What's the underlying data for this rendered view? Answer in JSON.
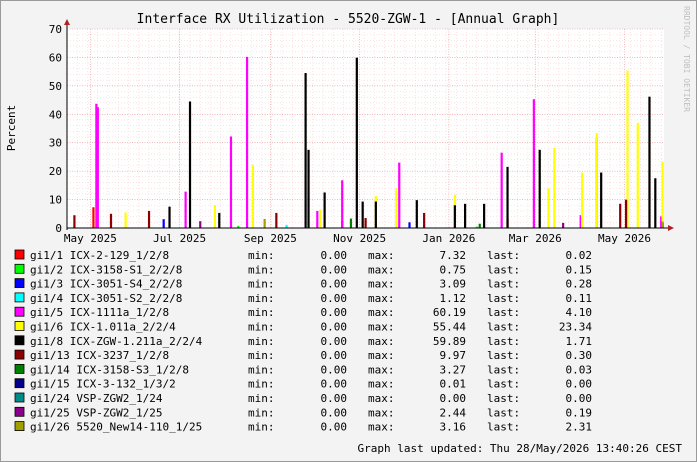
{
  "chart_data": {
    "type": "bar",
    "title": "Interface RX Utilization - 5520-ZGW-1 - [Annual Graph]",
    "ylabel": "Percent",
    "watermark": "RRDTOOL / TOBI OETIKER",
    "ylim": [
      0,
      70
    ],
    "y_ticks": [
      0,
      10,
      20,
      30,
      40,
      50,
      60,
      70
    ],
    "x_range": [
      "2025-04-15",
      "2026-05-28"
    ],
    "x_ticks": [
      {
        "label": "May 2025",
        "date": "2025-05-01"
      },
      {
        "label": "Jul 2025",
        "date": "2025-07-01"
      },
      {
        "label": "Sep 2025",
        "date": "2025-09-01"
      },
      {
        "label": "Nov 2025",
        "date": "2025-11-01"
      },
      {
        "label": "Jan 2026",
        "date": "2026-01-01"
      },
      {
        "label": "Mar 2026",
        "date": "2026-03-01"
      },
      {
        "label": "May 2026",
        "date": "2026-05-01"
      }
    ],
    "grid": true,
    "legend_columns": {
      "min": "min:",
      "max": "max:",
      "last": "last:"
    },
    "series": [
      {
        "name": "gi1/1 ICX-2-129_1/2/8",
        "color": "#ff0000",
        "min": "0.00",
        "max": "7.32",
        "last": "0.02",
        "peaks": [
          [
            "2025-05-03",
            7.3
          ],
          [
            "2026-02-10",
            3.2
          ],
          [
            "2025-10-20",
            2.5
          ]
        ]
      },
      {
        "name": "gi1/2 ICX-3158-S1_2/2/8",
        "color": "#00ff00",
        "min": "0.00",
        "max": "0.75",
        "last": "0.15",
        "peaks": [
          [
            "2025-08-10",
            0.75
          ],
          [
            "2026-01-20",
            0.5
          ]
        ]
      },
      {
        "name": "gi1/3 ICX-3051-S4_2/2/8",
        "color": "#0000ff",
        "min": "0.00",
        "max": "3.09",
        "last": "0.28",
        "peaks": [
          [
            "2025-06-20",
            3.1
          ],
          [
            "2025-12-05",
            2.0
          ]
        ]
      },
      {
        "name": "gi1/4 ICX-3051-S2_2/2/8",
        "color": "#00ffff",
        "min": "0.00",
        "max": "1.12",
        "last": "0.11",
        "peaks": [
          [
            "2025-09-12",
            1.1
          ]
        ]
      },
      {
        "name": "gi1/5 ICX-1111a_1/2/8",
        "color": "#ff00ff",
        "min": "0.00",
        "max": "60.19",
        "last": "4.10",
        "peaks": [
          [
            "2025-05-05",
            43.7
          ],
          [
            "2025-05-06",
            42.5
          ],
          [
            "2025-07-05",
            12.8
          ],
          [
            "2025-08-05",
            32.2
          ],
          [
            "2025-08-16",
            60.2
          ],
          [
            "2025-10-03",
            6.0
          ],
          [
            "2025-10-20",
            16.8
          ],
          [
            "2025-11-28",
            23.0
          ],
          [
            "2026-02-06",
            26.5
          ],
          [
            "2026-02-28",
            45.3
          ],
          [
            "2026-04-01",
            4.5
          ],
          [
            "2026-04-12",
            31.7
          ],
          [
            "2026-05-26",
            4.1
          ]
        ]
      },
      {
        "name": "gi1/6 ICX-1.011a_2/2/4",
        "color": "#ffff00",
        "min": "0.00",
        "max": "55.44",
        "last": "23.34",
        "peaks": [
          [
            "2025-05-25",
            5.5
          ],
          [
            "2025-07-25",
            8.0
          ],
          [
            "2025-08-20",
            22.2
          ],
          [
            "2025-10-05",
            6.5
          ],
          [
            "2025-11-12",
            11.2
          ],
          [
            "2025-11-26",
            14.0
          ],
          [
            "2026-01-05",
            11.7
          ],
          [
            "2026-03-10",
            14.0
          ],
          [
            "2026-03-14",
            28.2
          ],
          [
            "2026-04-02",
            19.5
          ],
          [
            "2026-04-12",
            33.4
          ],
          [
            "2026-05-03",
            55.4
          ],
          [
            "2026-05-10",
            37.0
          ],
          [
            "2026-05-27",
            23.3
          ]
        ]
      },
      {
        "name": "gi1/8 ICX-ZGW-1.211a_2/2/4",
        "color": "#000000",
        "min": "0.00",
        "max": "59.89",
        "last": "1.71",
        "peaks": [
          [
            "2025-06-24",
            7.5
          ],
          [
            "2025-07-08",
            44.5
          ],
          [
            "2025-07-28",
            5.3
          ],
          [
            "2025-09-25",
            54.5
          ],
          [
            "2025-09-27",
            27.5
          ],
          [
            "2025-10-08",
            12.5
          ],
          [
            "2025-10-30",
            59.9
          ],
          [
            "2025-11-03",
            9.3
          ],
          [
            "2025-11-12",
            9.3
          ],
          [
            "2025-12-10",
            9.8
          ],
          [
            "2026-01-05",
            8.0
          ],
          [
            "2026-01-12",
            8.5
          ],
          [
            "2026-01-25",
            8.5
          ],
          [
            "2026-02-10",
            21.5
          ],
          [
            "2026-03-04",
            27.5
          ],
          [
            "2026-04-15",
            19.5
          ],
          [
            "2026-05-18",
            46.2
          ],
          [
            "2026-05-22",
            17.5
          ],
          [
            "2026-05-27",
            1.7
          ]
        ]
      },
      {
        "name": "gi1/13 ICX-3237_1/2/8",
        "color": "#8b0000",
        "min": "0.00",
        "max": "9.97",
        "last": "0.30",
        "peaks": [
          [
            "2025-04-20",
            4.5
          ],
          [
            "2025-05-15",
            5.0
          ],
          [
            "2025-06-10",
            6.0
          ],
          [
            "2025-09-05",
            5.3
          ],
          [
            "2025-11-05",
            3.5
          ],
          [
            "2025-12-15",
            5.3
          ],
          [
            "2026-04-28",
            8.5
          ],
          [
            "2026-05-02",
            9.97
          ]
        ]
      },
      {
        "name": "gi1/14 ICX-3158-S3_1/2/8",
        "color": "#008000",
        "min": "0.00",
        "max": "3.27",
        "last": "0.03",
        "peaks": [
          [
            "2025-10-26",
            3.3
          ],
          [
            "2026-01-22",
            1.5
          ]
        ]
      },
      {
        "name": "gi1/15 ICX-3-132_1/3/2",
        "color": "#00008b",
        "min": "0.00",
        "max": "0.01",
        "last": "0.00",
        "peaks": []
      },
      {
        "name": "gi1/24 VSP-ZGW2_1/24",
        "color": "#008b8b",
        "min": "0.00",
        "max": "0.00",
        "last": "0.00",
        "peaks": []
      },
      {
        "name": "gi1/25 VSP-ZGW2_1/25",
        "color": "#8b008b",
        "min": "0.00",
        "max": "2.44",
        "last": "0.19",
        "peaks": [
          [
            "2025-07-15",
            2.4
          ],
          [
            "2026-03-20",
            1.8
          ]
        ]
      },
      {
        "name": "gi1/26 5520_New14-110_1/25",
        "color": "#a0a000",
        "min": "0.00",
        "max": "3.16",
        "last": "2.31",
        "peaks": [
          [
            "2025-08-28",
            3.2
          ],
          [
            "2026-05-27",
            2.3
          ]
        ]
      }
    ],
    "footer": "Graph last updated: Thu 28/May/2026 13:40:26 CEST"
  }
}
